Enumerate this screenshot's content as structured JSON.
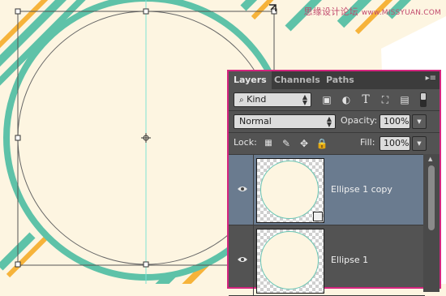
{
  "watermark": {
    "text": "思缘设计论坛",
    "site": "www.MISSYUAN.COM"
  },
  "colors": {
    "stripe_teal": "#5ec2a8",
    "stripe_orange": "#f6b33a",
    "canvas_bg": "#fdf5e1",
    "panel_border": "#d5257f",
    "guide": "#7fe3d3"
  },
  "panel": {
    "tabs": [
      {
        "label": "Layers",
        "active": true
      },
      {
        "label": "Channels",
        "active": false
      },
      {
        "label": "Paths",
        "active": false
      }
    ],
    "menu_icon": "panel-menu-icon",
    "filter": {
      "label": "Kind",
      "icon": "search-icon"
    },
    "filter_icons": [
      "image-filter-icon",
      "adjustment-filter-icon",
      "type-filter-icon",
      "shape-filter-icon",
      "smart-object-filter-icon"
    ],
    "type_glyph": "T",
    "blend_mode": "Normal",
    "opacity_label": "Opacity:",
    "opacity_value": "100%",
    "lock_label": "Lock:",
    "lock_icons": [
      "lock-transparent-icon",
      "lock-paint-icon",
      "lock-position-icon",
      "lock-all-icon"
    ],
    "fill_label": "Fill:",
    "fill_value": "100%",
    "layers": [
      {
        "name": "Ellipse 1 copy",
        "selected": true,
        "visible": true
      },
      {
        "name": "Ellipse 1",
        "selected": false,
        "visible": true
      }
    ]
  }
}
